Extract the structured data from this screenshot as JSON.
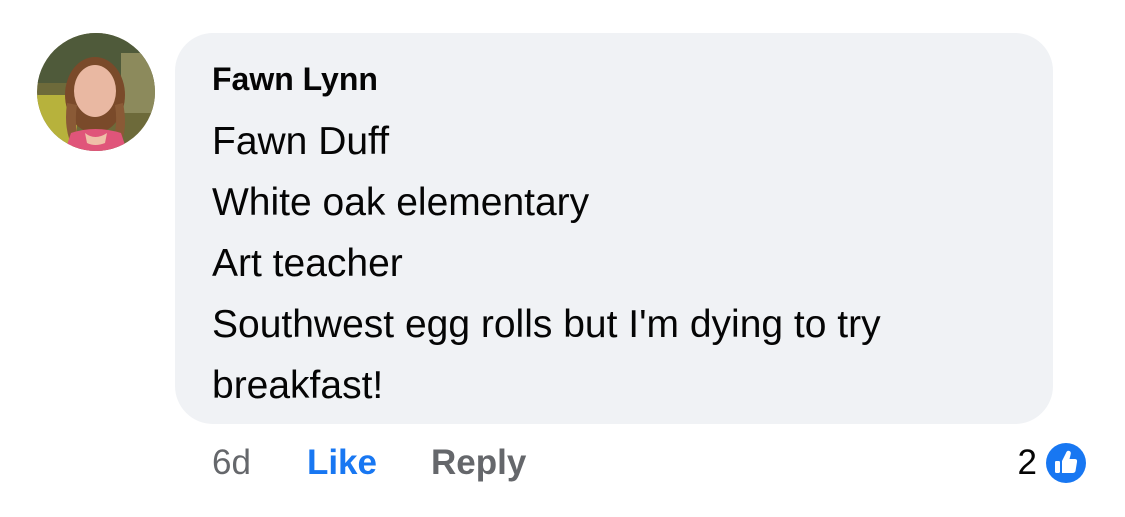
{
  "comment": {
    "author": "Fawn Lynn",
    "lines": [
      "Fawn Duff",
      "White oak elementary",
      "Art teacher",
      "Southwest egg rolls but I'm dying to try",
      "breakfast!"
    ],
    "avatar": "profile-photo"
  },
  "actions": {
    "timestamp": "6d",
    "like_label": "Like",
    "reply_label": "Reply"
  },
  "reactions": {
    "count": "2",
    "icon": "thumbs-up-icon",
    "color": "#1877f2"
  },
  "colors": {
    "bubble": "#f0f2f5",
    "accent": "#1877f2",
    "muted": "#65676b",
    "text": "#050505"
  }
}
